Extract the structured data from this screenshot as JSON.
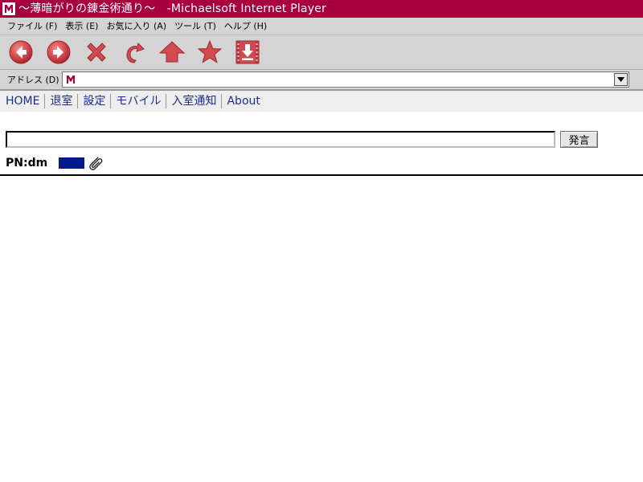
{
  "window": {
    "title": "～薄暗がりの錬金術通り～　-Michaelsoft Internet Player",
    "icon": "michaelsoft-m-icon"
  },
  "menubar": {
    "items": [
      {
        "label": "ファイル (F)"
      },
      {
        "label": "表示 (E)"
      },
      {
        "label": "お気に入り (A)"
      },
      {
        "label": "ツール (T)"
      },
      {
        "label": "ヘルプ (H)"
      }
    ]
  },
  "toolbar": {
    "buttons": [
      {
        "icon": "back-arrow-icon"
      },
      {
        "icon": "forward-arrow-icon"
      },
      {
        "icon": "stop-x-icon"
      },
      {
        "icon": "refresh-icon"
      },
      {
        "icon": "home-up-arrow-icon"
      },
      {
        "icon": "favorites-star-icon"
      },
      {
        "icon": "download-icon"
      }
    ],
    "accent_color": "#d0484e"
  },
  "address": {
    "label": "アドレス (D)",
    "value": "",
    "favicon": "michaelsoft-m-icon"
  },
  "nav": {
    "links": [
      {
        "label": "HOME"
      },
      {
        "label": "退室"
      },
      {
        "label": "設定"
      },
      {
        "label": "モバイル"
      },
      {
        "label": "入室通知"
      },
      {
        "label": "About"
      }
    ],
    "link_color": "#1a2e8a"
  },
  "chat": {
    "message_value": "",
    "submit_label": "発言",
    "pn_label": "PN:dm",
    "name_color": "#001a8c",
    "attach_icon": "paperclip-icon"
  },
  "colors": {
    "titlebar": "#a8003c",
    "chrome": "#d4d4d4"
  }
}
